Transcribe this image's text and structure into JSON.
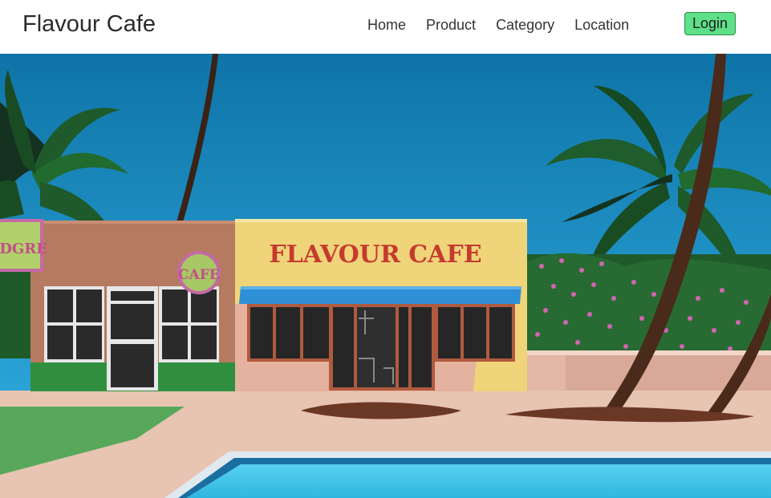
{
  "navbar": {
    "brand": "Flavour Cafe",
    "links": [
      "Home",
      "Product",
      "Category",
      "Location"
    ],
    "login_label": "Login",
    "login_color": "#5ee089"
  },
  "hero": {
    "sign_main": "FLAVOUR CAFE",
    "sign_round": "CAFE",
    "sign_left": "CDGRE",
    "colors": {
      "sky": "#1b8fc4",
      "building_yellow": "#efd47a",
      "building_brown": "#b47a5e",
      "awning": "#2e8fd6",
      "pool": "#3cc4e6",
      "patio": "#e6bca8"
    }
  }
}
